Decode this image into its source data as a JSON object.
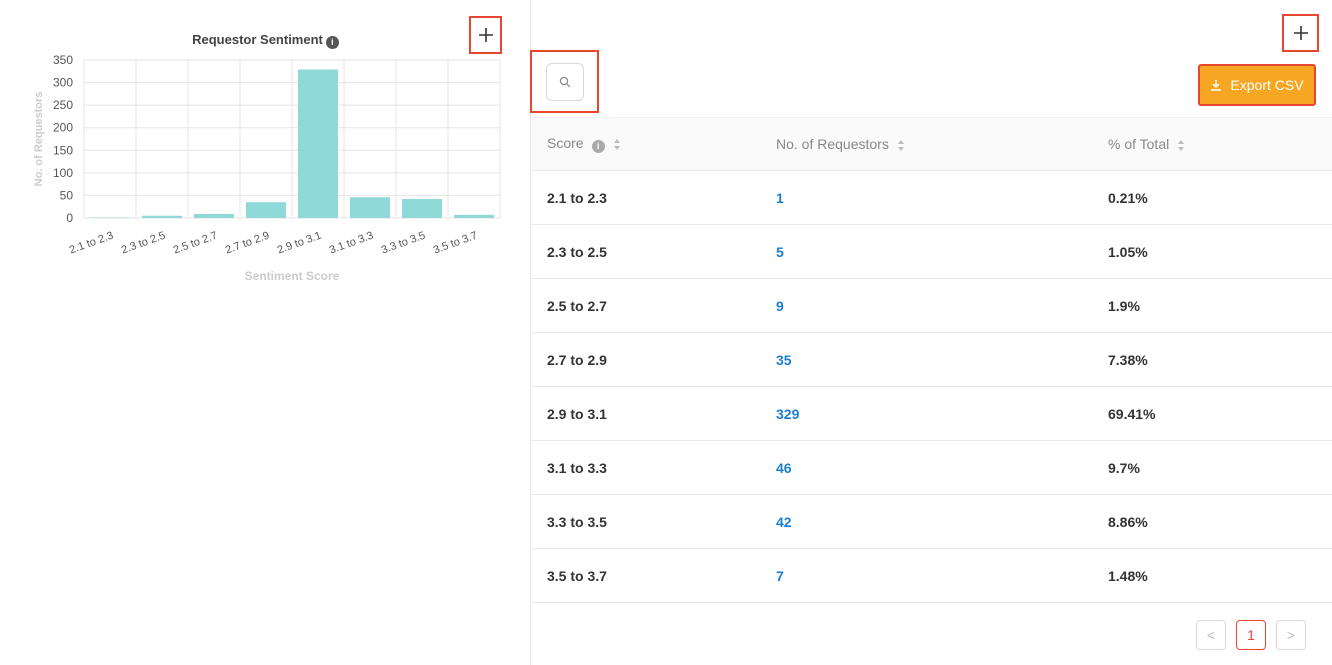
{
  "chart_panel": {
    "title": "Requestor Sentiment",
    "info_icon": "info-icon",
    "expand_icon": "plus-icon"
  },
  "chart_data": {
    "type": "bar",
    "title": "Requestor Sentiment",
    "xlabel": "Sentiment Score",
    "ylabel": "No. of Requestors",
    "categories": [
      "2.1 to 2.3",
      "2.3 to 2.5",
      "2.5 to 2.7",
      "2.7 to 2.9",
      "2.9 to 3.1",
      "3.1 to 3.3",
      "3.3 to 3.5",
      "3.5 to 3.7"
    ],
    "values": [
      1,
      5,
      9,
      35,
      329,
      46,
      42,
      7
    ],
    "ylim": [
      0,
      350
    ],
    "yticks": [
      0,
      50,
      100,
      150,
      200,
      250,
      300,
      350
    ],
    "grid": true,
    "bar_color": "#8fd9d8"
  },
  "table_panel": {
    "expand_icon": "plus-icon",
    "search_icon": "search-icon",
    "export_label": "Export CSV",
    "export_icon": "download-icon",
    "accent_color": "#f6a623",
    "columns": [
      "Score",
      "No. of Requestors",
      "% of Total"
    ],
    "rows": [
      {
        "score": "2.1 to 2.3",
        "count": "1",
        "pct": "0.21%"
      },
      {
        "score": "2.3 to 2.5",
        "count": "5",
        "pct": "1.05%"
      },
      {
        "score": "2.5 to 2.7",
        "count": "9",
        "pct": "1.9%"
      },
      {
        "score": "2.7 to 2.9",
        "count": "35",
        "pct": "7.38%"
      },
      {
        "score": "2.9 to 3.1",
        "count": "329",
        "pct": "69.41%"
      },
      {
        "score": "3.1 to 3.3",
        "count": "46",
        "pct": "9.7%"
      },
      {
        "score": "3.3 to 3.5",
        "count": "42",
        "pct": "8.86%"
      },
      {
        "score": "3.5 to 3.7",
        "count": "7",
        "pct": "1.48%"
      }
    ],
    "pagination": {
      "prev": "<",
      "page": "1",
      "next": ">"
    }
  }
}
